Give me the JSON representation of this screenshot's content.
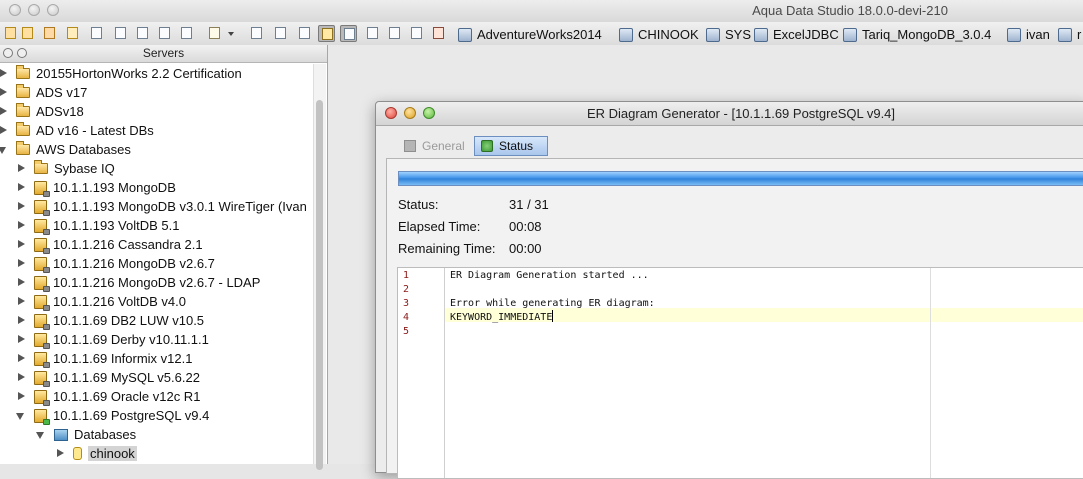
{
  "app": {
    "title": "Aqua Data Studio 18.0.0-devi-210"
  },
  "toolbar": {
    "connections": [
      {
        "label": "AdventureWorks2014"
      },
      {
        "label": "CHINOOK"
      },
      {
        "label": "SYS"
      },
      {
        "label": "ExcelJDBC"
      },
      {
        "label": "Tariq_MongoDB_3.0.4"
      },
      {
        "label": "ivan"
      },
      {
        "label": "r"
      }
    ]
  },
  "servers_panel": {
    "title": "Servers",
    "items": [
      {
        "label": "20155HortonWorks 2.2 Certification"
      },
      {
        "label": "ADS v17"
      },
      {
        "label": "ADSv18"
      },
      {
        "label": "AD v16 - Latest DBs"
      },
      {
        "label": "AWS Databases"
      },
      {
        "label": "Sybase IQ"
      },
      {
        "label": "10.1.1.193 MongoDB"
      },
      {
        "label": "10.1.1.193 MongoDB v3.0.1 WireTiger (Ivan"
      },
      {
        "label": "10.1.1.193 VoltDB 5.1"
      },
      {
        "label": "10.1.1.216 Cassandra 2.1"
      },
      {
        "label": "10.1.1.216 MongoDB v2.6.7"
      },
      {
        "label": "10.1.1.216 MongoDB v2.6.7 - LDAP"
      },
      {
        "label": "10.1.1.216 VoltDB  v4.0"
      },
      {
        "label": "10.1.1.69 DB2 LUW v10.5"
      },
      {
        "label": "10.1.1.69 Derby v10.11.1.1"
      },
      {
        "label": "10.1.1.69 Informix v12.1"
      },
      {
        "label": "10.1.1.69 MySQL v5.6.22"
      },
      {
        "label": "10.1.1.69 Oracle  v12c R1"
      },
      {
        "label": "10.1.1.69 PostgreSQL  v9.4"
      },
      {
        "label": "Databases"
      },
      {
        "label": "chinook"
      }
    ]
  },
  "dialog": {
    "title": "ER Diagram Generator - [10.1.1.69 PostgreSQL  v9.4]",
    "tabs": {
      "general": "General",
      "status": "Status"
    },
    "progress": 1.0,
    "status_label": "Status:",
    "status_value": "31 / 31",
    "elapsed_label": "Elapsed Time:",
    "elapsed_value": "00:08",
    "remaining_label": "Remaining Time:",
    "remaining_value": "00:00",
    "log_lines": [
      {
        "num": "1",
        "text": "ER Diagram Generation started ..."
      },
      {
        "num": "2",
        "text": ""
      },
      {
        "num": "3",
        "text": "Error while generating ER diagram:"
      },
      {
        "num": "4",
        "text": "KEYWORD_IMMEDIATE"
      },
      {
        "num": "5",
        "text": ""
      }
    ]
  }
}
